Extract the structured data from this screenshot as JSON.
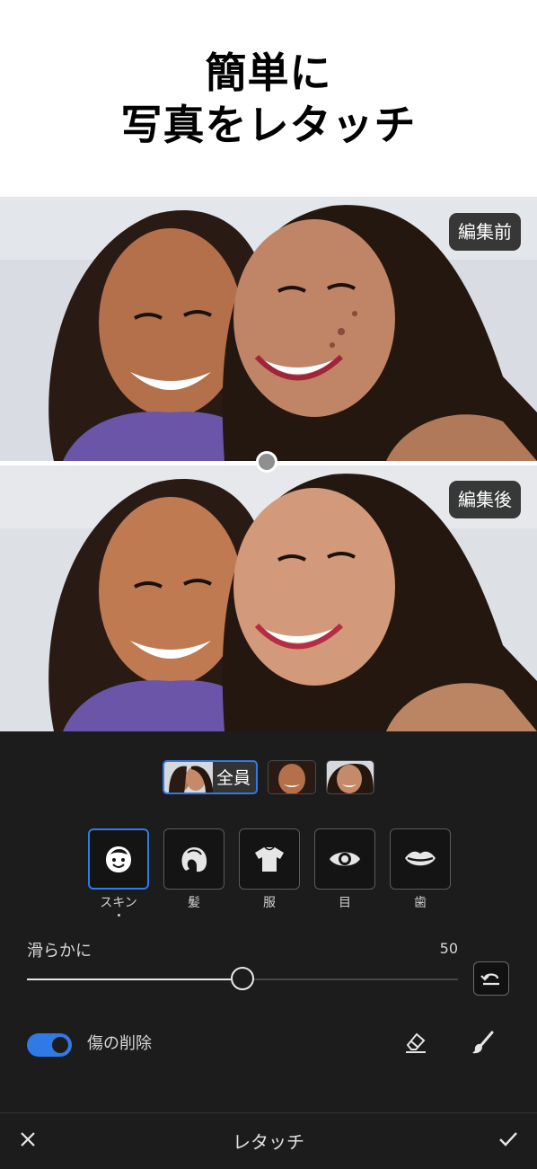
{
  "headline": {
    "line1": "簡単に",
    "line2": "写真をレタッチ"
  },
  "photo": {
    "before_badge": "編集前",
    "after_badge": "編集後"
  },
  "faces": {
    "all_label": "全員",
    "selected": "all"
  },
  "tools": [
    {
      "label": "スキン",
      "icon": "face-icon",
      "selected": true
    },
    {
      "label": "髪",
      "icon": "hair-icon",
      "selected": false
    },
    {
      "label": "服",
      "icon": "shirt-icon",
      "selected": false
    },
    {
      "label": "目",
      "icon": "eye-icon",
      "selected": false
    },
    {
      "label": "歯",
      "icon": "lips-icon",
      "selected": false
    }
  ],
  "smoothing": {
    "label": "滑らかに",
    "value": "50",
    "fraction": 0.5
  },
  "blemish": {
    "label": "傷の削除",
    "enabled": true
  },
  "bottom_bar": {
    "title": "レタッチ"
  },
  "colors": {
    "accent": "#2f7ae5",
    "panel": "#1c1c1c"
  }
}
